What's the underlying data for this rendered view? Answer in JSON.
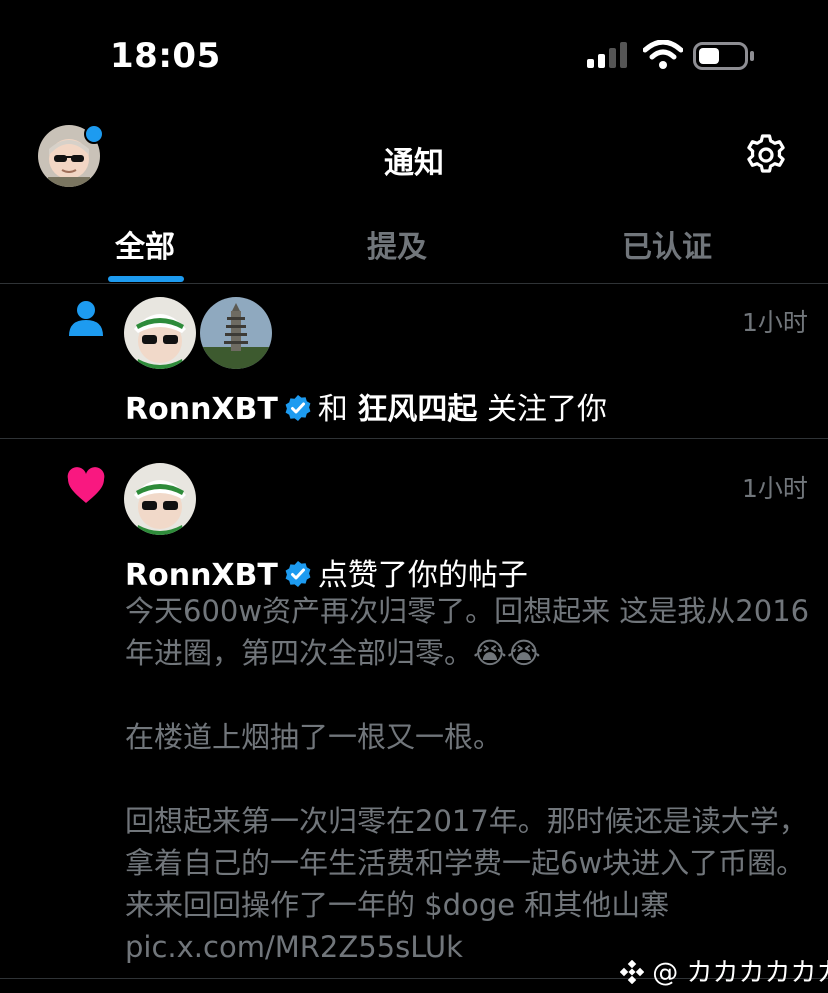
{
  "status_bar": {
    "time": "18:05"
  },
  "header": {
    "title": "通知"
  },
  "tabs": {
    "all": "全部",
    "mentions": "提及",
    "verified": "已认证"
  },
  "notifications": [
    {
      "type_icon": "person-follow-icon",
      "timestamp": "1小时",
      "user1": "RonnXBT",
      "connector": "和",
      "user2": "狂风四起",
      "action": "关注了你"
    },
    {
      "type_icon": "heart-icon",
      "timestamp": "1小时",
      "user": "RonnXBT",
      "action": "点赞了你的帖子",
      "post_text": "今天600w资产再次归零了。回想起来 这是我从2016年进圈，第四次全部归零。😭😭\n\n在楼道上烟抽了一根又一根。\n\n回想起来第一次归零在2017年。那时候还是读大学，拿着自己的一年生活费和学费一起6w块进入了币圈。来来回回操作了一年的 $doge 和其他山寨 pic.x.com/MR2Z55sLUk"
    }
  ],
  "watermark": "@ カカカカカカ",
  "colors": {
    "accent": "#1d9bf0",
    "like": "#f91880",
    "background": "#000000"
  }
}
